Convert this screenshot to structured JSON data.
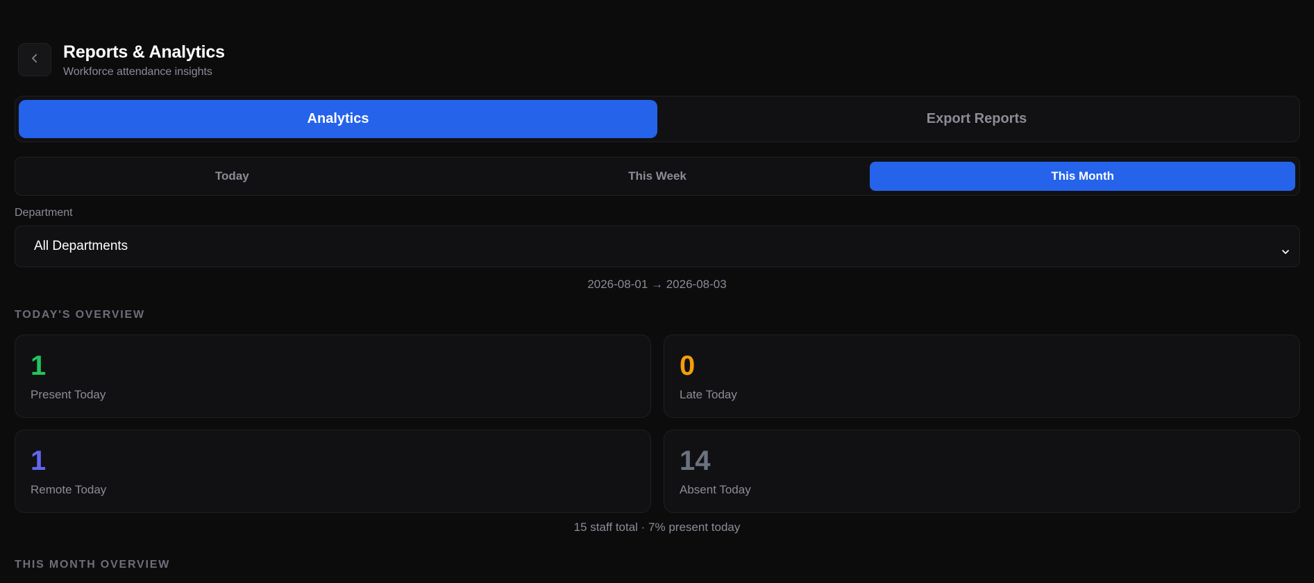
{
  "header": {
    "title": "Reports & Analytics",
    "subtitle": "Workforce attendance insights"
  },
  "main_tabs": [
    {
      "label": "Analytics",
      "active": true
    },
    {
      "label": "Export Reports",
      "active": false
    }
  ],
  "period_tabs": [
    {
      "label": "Today",
      "active": false
    },
    {
      "label": "This Week",
      "active": false
    },
    {
      "label": "This Month",
      "active": true
    }
  ],
  "department": {
    "label": "Department",
    "selected": "All Departments"
  },
  "date_range": "2026-08-01 → 2026-08-03",
  "today_overview": {
    "heading": "TODAY'S OVERVIEW",
    "cards": [
      {
        "value": "1",
        "label": "Present Today",
        "color": "#22c55e"
      },
      {
        "value": "0",
        "label": "Late Today",
        "color": "#f59e0b"
      },
      {
        "value": "1",
        "label": "Remote Today",
        "color": "#6366f1"
      },
      {
        "value": "14",
        "label": "Absent Today",
        "color": "#6b7280"
      }
    ],
    "summary": "15 staff total · 7% present today"
  },
  "month_overview": {
    "heading": "THIS MONTH OVERVIEW"
  },
  "colors": {
    "accent": "#2563eb",
    "background": "#0c0c0d",
    "card": "#111113"
  },
  "icons": {
    "back": "chevron-left-icon",
    "dropdown": "chevron-down-icon"
  }
}
